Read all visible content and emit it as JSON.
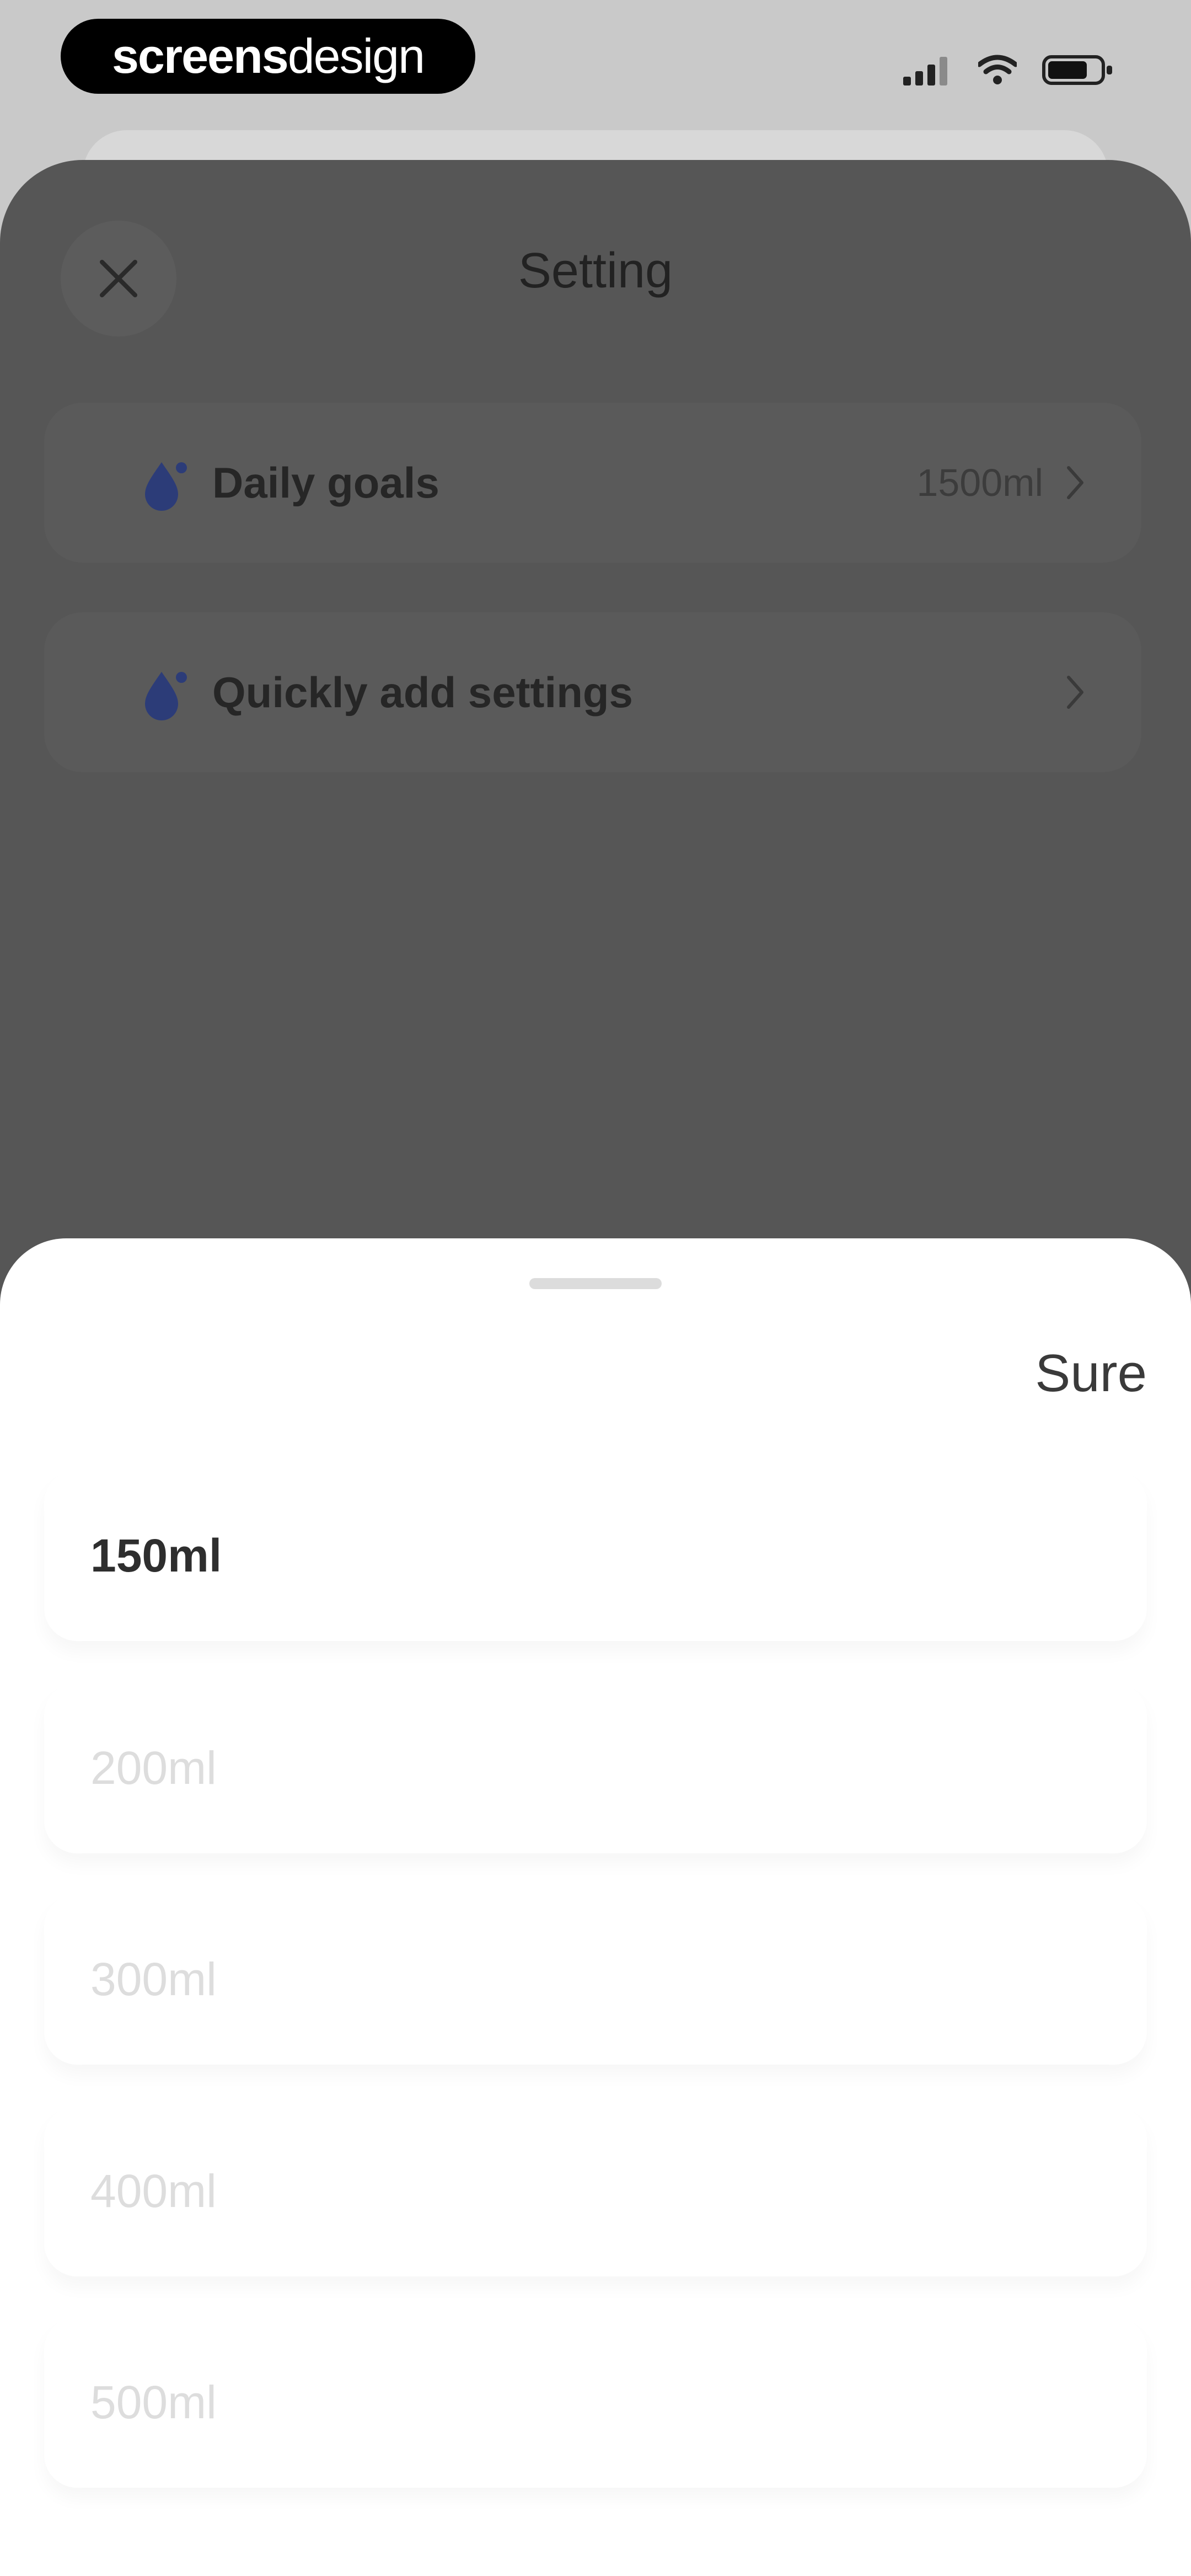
{
  "status_bar": {
    "brand_bold": "screens",
    "brand_light": "design"
  },
  "settings": {
    "title": "Setting",
    "rows": [
      {
        "label": "Daily goals",
        "value": "1500ml"
      },
      {
        "label": "Quickly add settings",
        "value": ""
      }
    ]
  },
  "picker": {
    "confirm_label": "Sure",
    "options": [
      "150ml",
      "200ml",
      "300ml",
      "400ml",
      "500ml"
    ],
    "selected_index": 0
  },
  "colors": {
    "overlay": "#565656",
    "sheet": "#ffffff",
    "accent_icon": "#2c3c78"
  },
  "icons": {
    "close": "close-icon",
    "row": "water-drop-icon",
    "chevron": "chevron-right-icon",
    "signal": "signal-icon",
    "wifi": "wifi-icon",
    "battery": "battery-icon"
  }
}
